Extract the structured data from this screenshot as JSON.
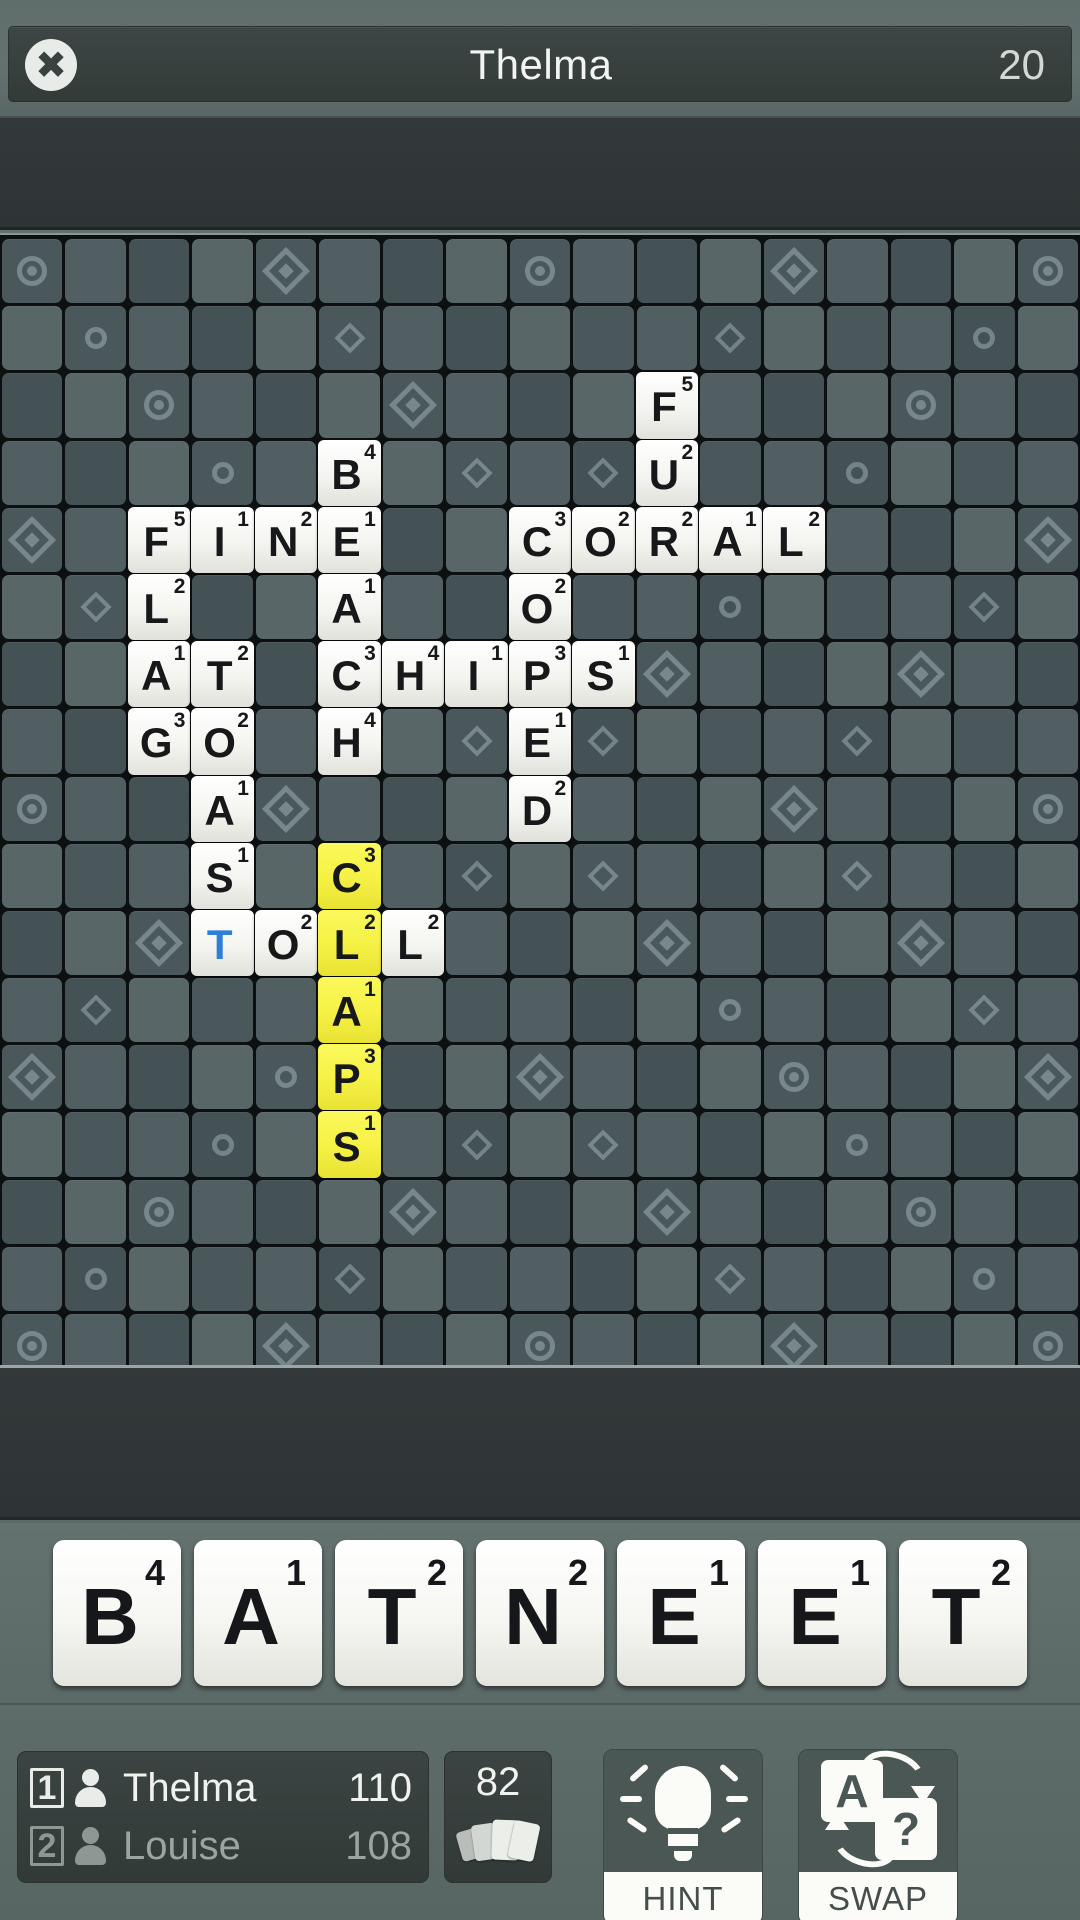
{
  "topbar": {
    "close_icon": "close-icon",
    "title": "Thelma",
    "score": "20"
  },
  "board": {
    "cols": 17,
    "rows": 17,
    "tiles": [
      {
        "r": 2,
        "c": 10,
        "letter": "F",
        "value": "5"
      },
      {
        "r": 3,
        "c": 5,
        "letter": "B",
        "value": "4"
      },
      {
        "r": 3,
        "c": 10,
        "letter": "U",
        "value": "2"
      },
      {
        "r": 4,
        "c": 2,
        "letter": "F",
        "value": "5"
      },
      {
        "r": 4,
        "c": 3,
        "letter": "I",
        "value": "1"
      },
      {
        "r": 4,
        "c": 4,
        "letter": "N",
        "value": "2"
      },
      {
        "r": 4,
        "c": 5,
        "letter": "E",
        "value": "1"
      },
      {
        "r": 4,
        "c": 8,
        "letter": "C",
        "value": "3"
      },
      {
        "r": 4,
        "c": 9,
        "letter": "O",
        "value": "2"
      },
      {
        "r": 4,
        "c": 10,
        "letter": "R",
        "value": "2"
      },
      {
        "r": 4,
        "c": 11,
        "letter": "A",
        "value": "1"
      },
      {
        "r": 4,
        "c": 12,
        "letter": "L",
        "value": "2"
      },
      {
        "r": 5,
        "c": 2,
        "letter": "L",
        "value": "2"
      },
      {
        "r": 5,
        "c": 5,
        "letter": "A",
        "value": "1"
      },
      {
        "r": 5,
        "c": 8,
        "letter": "O",
        "value": "2"
      },
      {
        "r": 6,
        "c": 2,
        "letter": "A",
        "value": "1"
      },
      {
        "r": 6,
        "c": 3,
        "letter": "T",
        "value": "2"
      },
      {
        "r": 6,
        "c": 5,
        "letter": "C",
        "value": "3"
      },
      {
        "r": 6,
        "c": 6,
        "letter": "H",
        "value": "4"
      },
      {
        "r": 6,
        "c": 7,
        "letter": "I",
        "value": "1"
      },
      {
        "r": 6,
        "c": 8,
        "letter": "P",
        "value": "3"
      },
      {
        "r": 6,
        "c": 9,
        "letter": "S",
        "value": "1"
      },
      {
        "r": 7,
        "c": 2,
        "letter": "G",
        "value": "3"
      },
      {
        "r": 7,
        "c": 3,
        "letter": "O",
        "value": "2"
      },
      {
        "r": 7,
        "c": 5,
        "letter": "H",
        "value": "4"
      },
      {
        "r": 7,
        "c": 8,
        "letter": "E",
        "value": "1"
      },
      {
        "r": 8,
        "c": 3,
        "letter": "A",
        "value": "1"
      },
      {
        "r": 8,
        "c": 8,
        "letter": "D",
        "value": "2"
      },
      {
        "r": 9,
        "c": 3,
        "letter": "S",
        "value": "1"
      },
      {
        "r": 9,
        "c": 5,
        "letter": "C",
        "value": "3",
        "highlight": true
      },
      {
        "r": 10,
        "c": 3,
        "letter": "T",
        "value": "",
        "blank": true
      },
      {
        "r": 10,
        "c": 4,
        "letter": "O",
        "value": "2"
      },
      {
        "r": 10,
        "c": 5,
        "letter": "L",
        "value": "2",
        "highlight": true
      },
      {
        "r": 10,
        "c": 6,
        "letter": "L",
        "value": "2"
      },
      {
        "r": 11,
        "c": 5,
        "letter": "A",
        "value": "1",
        "highlight": true
      },
      {
        "r": 12,
        "c": 5,
        "letter": "P",
        "value": "3",
        "highlight": true
      },
      {
        "r": 13,
        "c": 5,
        "letter": "S",
        "value": "1",
        "highlight": true
      }
    ],
    "bonuses": [
      {
        "r": 0,
        "c": 0,
        "kind": "tw"
      },
      {
        "r": 0,
        "c": 4,
        "kind": "tl"
      },
      {
        "r": 0,
        "c": 8,
        "kind": "tw"
      },
      {
        "r": 0,
        "c": 12,
        "kind": "tl"
      },
      {
        "r": 0,
        "c": 16,
        "kind": "tw"
      },
      {
        "r": 1,
        "c": 1,
        "kind": "dw"
      },
      {
        "r": 1,
        "c": 5,
        "kind": "dl"
      },
      {
        "r": 1,
        "c": 11,
        "kind": "dl"
      },
      {
        "r": 1,
        "c": 15,
        "kind": "dw"
      },
      {
        "r": 2,
        "c": 2,
        "kind": "tw"
      },
      {
        "r": 2,
        "c": 6,
        "kind": "tl"
      },
      {
        "r": 2,
        "c": 14,
        "kind": "tw"
      },
      {
        "r": 3,
        "c": 3,
        "kind": "dw"
      },
      {
        "r": 3,
        "c": 7,
        "kind": "dl"
      },
      {
        "r": 3,
        "c": 9,
        "kind": "dl"
      },
      {
        "r": 3,
        "c": 13,
        "kind": "dw"
      },
      {
        "r": 4,
        "c": 0,
        "kind": "tl"
      },
      {
        "r": 4,
        "c": 16,
        "kind": "tl"
      },
      {
        "r": 5,
        "c": 1,
        "kind": "dl"
      },
      {
        "r": 5,
        "c": 11,
        "kind": "dw"
      },
      {
        "r": 5,
        "c": 15,
        "kind": "dl"
      },
      {
        "r": 6,
        "c": 10,
        "kind": "tl"
      },
      {
        "r": 6,
        "c": 14,
        "kind": "tl"
      },
      {
        "r": 7,
        "c": 7,
        "kind": "dl"
      },
      {
        "r": 7,
        "c": 9,
        "kind": "dl"
      },
      {
        "r": 7,
        "c": 13,
        "kind": "dl"
      },
      {
        "r": 8,
        "c": 0,
        "kind": "tw"
      },
      {
        "r": 8,
        "c": 4,
        "kind": "tl"
      },
      {
        "r": 8,
        "c": 12,
        "kind": "tl"
      },
      {
        "r": 8,
        "c": 16,
        "kind": "tw"
      },
      {
        "r": 9,
        "c": 7,
        "kind": "dl"
      },
      {
        "r": 9,
        "c": 9,
        "kind": "dl"
      },
      {
        "r": 9,
        "c": 13,
        "kind": "dl"
      },
      {
        "r": 10,
        "c": 2,
        "kind": "tl"
      },
      {
        "r": 10,
        "c": 10,
        "kind": "tl"
      },
      {
        "r": 10,
        "c": 14,
        "kind": "tl"
      },
      {
        "r": 11,
        "c": 1,
        "kind": "dl"
      },
      {
        "r": 11,
        "c": 11,
        "kind": "dw"
      },
      {
        "r": 11,
        "c": 15,
        "kind": "dl"
      },
      {
        "r": 12,
        "c": 0,
        "kind": "tl"
      },
      {
        "r": 12,
        "c": 4,
        "kind": "dw"
      },
      {
        "r": 12,
        "c": 8,
        "kind": "tl"
      },
      {
        "r": 12,
        "c": 12,
        "kind": "tw"
      },
      {
        "r": 12,
        "c": 16,
        "kind": "tl"
      },
      {
        "r": 13,
        "c": 3,
        "kind": "dw"
      },
      {
        "r": 13,
        "c": 7,
        "kind": "dl"
      },
      {
        "r": 13,
        "c": 9,
        "kind": "dl"
      },
      {
        "r": 13,
        "c": 13,
        "kind": "dw"
      },
      {
        "r": 14,
        "c": 2,
        "kind": "tw"
      },
      {
        "r": 14,
        "c": 6,
        "kind": "tl"
      },
      {
        "r": 14,
        "c": 10,
        "kind": "tl"
      },
      {
        "r": 14,
        "c": 14,
        "kind": "tw"
      },
      {
        "r": 15,
        "c": 1,
        "kind": "dw"
      },
      {
        "r": 15,
        "c": 5,
        "kind": "dl"
      },
      {
        "r": 15,
        "c": 11,
        "kind": "dl"
      },
      {
        "r": 15,
        "c": 15,
        "kind": "dw"
      },
      {
        "r": 16,
        "c": 0,
        "kind": "tw"
      },
      {
        "r": 16,
        "c": 4,
        "kind": "tl"
      },
      {
        "r": 16,
        "c": 8,
        "kind": "tw"
      },
      {
        "r": 16,
        "c": 12,
        "kind": "tl"
      },
      {
        "r": 16,
        "c": 16,
        "kind": "tw"
      }
    ]
  },
  "rack": {
    "tiles": [
      {
        "letter": "B",
        "value": "4"
      },
      {
        "letter": "A",
        "value": "1"
      },
      {
        "letter": "T",
        "value": "2"
      },
      {
        "letter": "N",
        "value": "2"
      },
      {
        "letter": "E",
        "value": "1"
      },
      {
        "letter": "E",
        "value": "1"
      },
      {
        "letter": "T",
        "value": "2"
      }
    ]
  },
  "hud": {
    "players": [
      {
        "rank": "1",
        "name": "Thelma",
        "score": "110",
        "active": true
      },
      {
        "rank": "2",
        "name": "Louise",
        "score": "108",
        "active": false
      }
    ],
    "bag_count": "82",
    "hint_label": "HINT",
    "swap_label": "SWAP",
    "swap_letter": "A",
    "swap_unknown": "?"
  }
}
